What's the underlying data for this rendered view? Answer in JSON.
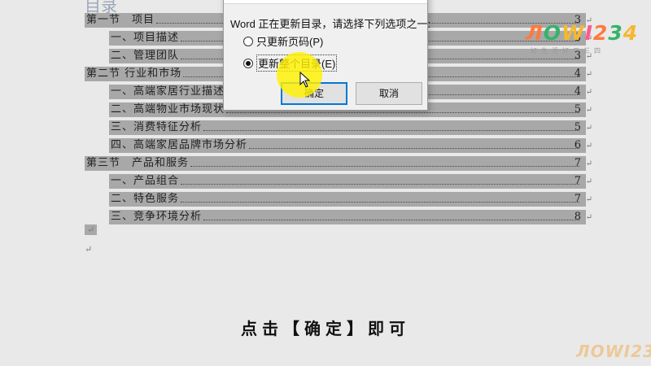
{
  "document": {
    "heading": "目录",
    "toc": [
      {
        "level": 1,
        "text": "第一节　项目",
        "page": "3"
      },
      {
        "level": 2,
        "text": "一、项目描述",
        "page": "3"
      },
      {
        "level": 2,
        "text": "二、管理团队",
        "page": "3"
      },
      {
        "level": 1,
        "text": "第二节  行业和市场",
        "page": "4"
      },
      {
        "level": 2,
        "text": "一、高端家居行业描述",
        "page": "4"
      },
      {
        "level": 2,
        "text": "二、高端物业市场现状",
        "page": "5"
      },
      {
        "level": 2,
        "text": "三、消费特征分析",
        "page": "5"
      },
      {
        "level": 2,
        "text": "四、高端家居品牌市场分析",
        "page": "6"
      },
      {
        "level": 1,
        "text": "第三节　产品和服务",
        "page": "7"
      },
      {
        "level": 2,
        "text": "一、产品组合",
        "page": "7"
      },
      {
        "level": 2,
        "text": "二、特色服务",
        "page": "7"
      },
      {
        "level": 2,
        "text": "三、竞争环境分析",
        "page": "8"
      }
    ],
    "para_mark": "↵"
  },
  "dialog": {
    "prompt": "Word 正在更新目录，请选择下列选项之一:",
    "option1": "只更新页码(P)",
    "option2": "更新整个目录(E)",
    "selected_option": 2,
    "ok_label": "确定",
    "cancel_label": "取消"
  },
  "caption": "点击【确定】即可",
  "watermark": {
    "brand": "ЛOWI234",
    "tagline": "好生活好二三四"
  },
  "colors": {
    "selection": "#a8a8a8",
    "highlight": "#fff000",
    "ok_border": "#0078d7"
  }
}
